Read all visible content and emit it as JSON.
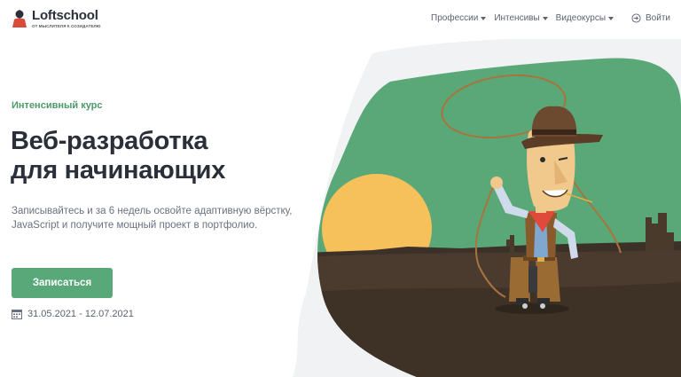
{
  "header": {
    "brand": "Loftschool",
    "brand_tagline": "от мыслителя к созидателю",
    "nav": [
      {
        "label": "Профессии"
      },
      {
        "label": "Интенсивы"
      },
      {
        "label": "Видеокурсы"
      }
    ],
    "login_label": "Войти"
  },
  "hero": {
    "eyebrow": "Интенсивный курс",
    "title_line1": "Веб-разработка",
    "title_line2": "для начинающих",
    "description": "Записывайтесь и за 6 недель освойте адаптивную вёрстку, JavaScript и получите мощный проект в портфолио.",
    "cta_label": "Записаться",
    "dates": "31.05.2021 - 12.07.2021"
  },
  "colors": {
    "accent": "#58a87a",
    "eyebrow": "#4d9a6b",
    "sky": "#5aa878",
    "sun": "#f6c05a",
    "ground": "#4a3a2c"
  },
  "icons": [
    "loftschool-logo-icon",
    "login-icon",
    "calendar-icon",
    "cowboy-illustration"
  ]
}
